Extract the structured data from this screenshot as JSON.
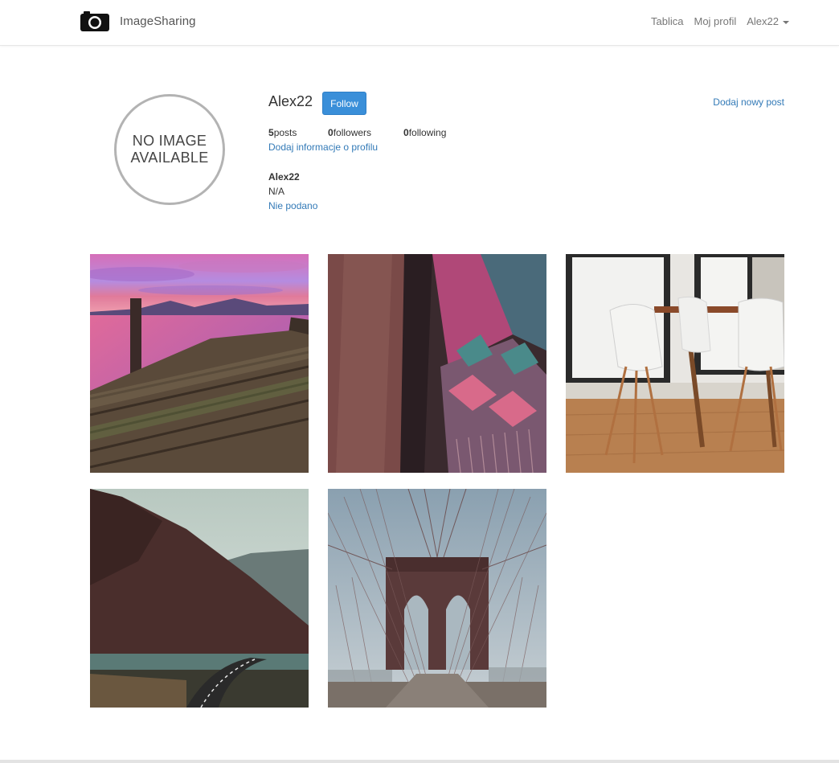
{
  "navbar": {
    "brand": "ImageSharing",
    "brand_icon": "camera-icon",
    "links": [
      "Tablica",
      "Moj profil"
    ],
    "user_menu": "Alex22"
  },
  "profile": {
    "avatar_text_line1": "NO IMAGE",
    "avatar_text_line2": "AVAILABLE",
    "username": "Alex22",
    "follow_label": "Follow",
    "add_post_label": "Dodaj nowy post",
    "posts_count": "5",
    "posts_label": "posts",
    "followers_count": "0",
    "followers_label": "followers",
    "following_count": "0",
    "following_label": "following",
    "edit_info_link": "Dodaj informacje o profilu",
    "bio_name": "Alex22",
    "bio_description": "N/A",
    "bio_website": "Nie podano"
  },
  "photos": [
    {
      "subject": "pier-sunset"
    },
    {
      "subject": "woven-textile"
    },
    {
      "subject": "dining-room-chairs"
    },
    {
      "subject": "mountain-road"
    },
    {
      "subject": "suspension-bridge"
    }
  ],
  "colors": {
    "accent": "#3a8fd9",
    "link": "#337ab7"
  }
}
